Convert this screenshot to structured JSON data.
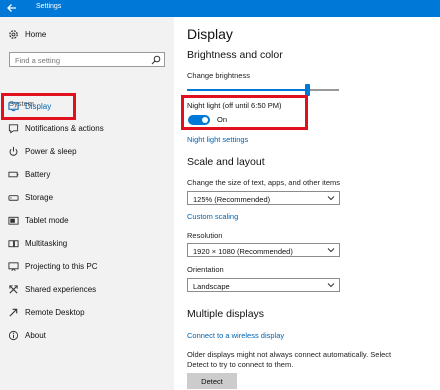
{
  "window": {
    "title": "Settings",
    "accent": "#0078d7",
    "highlight": "#e0101e"
  },
  "sidebar": {
    "home": {
      "label": "Home",
      "icon": "gear-icon"
    },
    "search": {
      "placeholder": "Find a setting",
      "icon": "search-icon"
    },
    "section": "System",
    "items": [
      {
        "label": "Display",
        "icon": "display-icon",
        "selected": true
      },
      {
        "label": "Notifications & actions",
        "icon": "notifications-icon"
      },
      {
        "label": "Power & sleep",
        "icon": "power-icon"
      },
      {
        "label": "Battery",
        "icon": "battery-icon"
      },
      {
        "label": "Storage",
        "icon": "storage-icon"
      },
      {
        "label": "Tablet mode",
        "icon": "tablet-icon"
      },
      {
        "label": "Multitasking",
        "icon": "multitasking-icon"
      },
      {
        "label": "Projecting to this PC",
        "icon": "projecting-icon"
      },
      {
        "label": "Shared experiences",
        "icon": "shared-icon"
      },
      {
        "label": "Remote Desktop",
        "icon": "remote-desktop-icon"
      },
      {
        "label": "About",
        "icon": "info-icon"
      }
    ]
  },
  "main": {
    "title": "Display",
    "brightness": {
      "heading": "Brightness and color",
      "label": "Change brightness",
      "level_percent": 79
    },
    "night_light": {
      "label": "Night light (off until 6:50 PM)",
      "toggle_state": "On",
      "settings_link": "Night light settings"
    },
    "scale": {
      "heading": "Scale and layout",
      "size_label": "Change the size of text, apps, and other items",
      "size_value": "125% (Recommended)",
      "custom_link": "Custom scaling",
      "resolution_label": "Resolution",
      "resolution_value": "1920 × 1080 (Recommended)",
      "orientation_label": "Orientation",
      "orientation_value": "Landscape"
    },
    "multiple": {
      "heading": "Multiple displays",
      "connect_link": "Connect to a wireless display",
      "note_line1": "Older displays might not always connect automatically. Select",
      "note_line2": "Detect to try to connect to them.",
      "detect_label": "Detect"
    }
  }
}
